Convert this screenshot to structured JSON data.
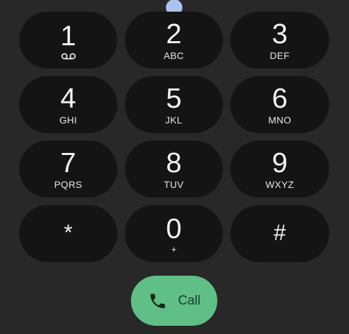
{
  "keypad": {
    "keys": [
      {
        "digit": "1",
        "letters": "",
        "sub_icon": "voicemail-icon"
      },
      {
        "digit": "2",
        "letters": "ABC"
      },
      {
        "digit": "3",
        "letters": "DEF"
      },
      {
        "digit": "4",
        "letters": "GHI"
      },
      {
        "digit": "5",
        "letters": "JKL"
      },
      {
        "digit": "6",
        "letters": "MNO"
      },
      {
        "digit": "7",
        "letters": "PQRS"
      },
      {
        "digit": "8",
        "letters": "TUV"
      },
      {
        "digit": "9",
        "letters": "WXYZ"
      },
      {
        "digit": "*",
        "letters": ""
      },
      {
        "digit": "0",
        "letters": "+"
      },
      {
        "digit": "#",
        "letters": ""
      }
    ]
  },
  "call": {
    "label": "Call",
    "icon": "phone-icon"
  },
  "colors": {
    "background": "#282828",
    "key": "#141414",
    "call_button": "#5fbf86",
    "touch_indicator": "#a9c4ef"
  }
}
